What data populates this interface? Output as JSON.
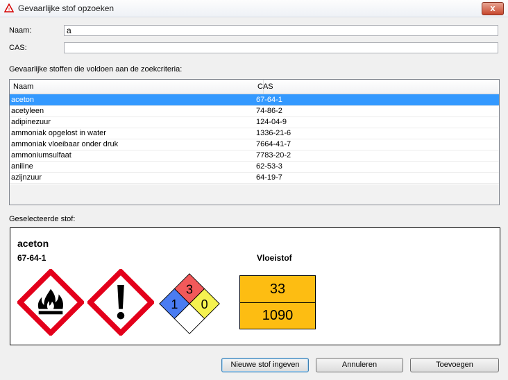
{
  "window": {
    "title": "Gevaarlijke stof opzoeken",
    "close_label": "x"
  },
  "search": {
    "name_label": "Naam:",
    "name_value": "a",
    "cas_label": "CAS:",
    "cas_value": ""
  },
  "results": {
    "label": "Gevaarlijke stoffen die voldoen aan de zoekcriteria:",
    "columns": [
      "Naam",
      "CAS"
    ],
    "rows": [
      {
        "name": "aceton",
        "cas": "67-64-1"
      },
      {
        "name": "acetyleen",
        "cas": "74-86-2"
      },
      {
        "name": "adipinezuur",
        "cas": "124-04-9"
      },
      {
        "name": "ammoniak opgelost in water",
        "cas": "1336-21-6"
      },
      {
        "name": "ammoniak vloeibaar onder druk",
        "cas": "7664-41-7"
      },
      {
        "name": "ammoniumsulfaat",
        "cas": "7783-20-2"
      },
      {
        "name": "aniline",
        "cas": "62-53-3"
      },
      {
        "name": "azijnzuur",
        "cas": "64-19-7"
      }
    ],
    "selected_index": 0
  },
  "selected": {
    "label": "Geselecteerde stof:",
    "name": "aceton",
    "cas": "67-64-1",
    "state": "Vloeistof",
    "pictograms": [
      "flame-pictogram-icon",
      "exclamation-pictogram-icon"
    ],
    "nfpa": {
      "health": "1",
      "flammability": "3",
      "reactivity": "0",
      "special": ""
    },
    "adr": {
      "hazard_number": "33",
      "un_number": "1090"
    }
  },
  "buttons": {
    "new": "Nieuwe stof ingeven",
    "cancel": "Annuleren",
    "add": "Toevoegen"
  },
  "colors": {
    "selection": "#3399ff",
    "ghs_red": "#e3001b",
    "adr_orange": "#fdbd12",
    "nfpa_red": "#f2595a",
    "nfpa_blue": "#4a7cf1",
    "nfpa_yellow": "#f5f250"
  }
}
